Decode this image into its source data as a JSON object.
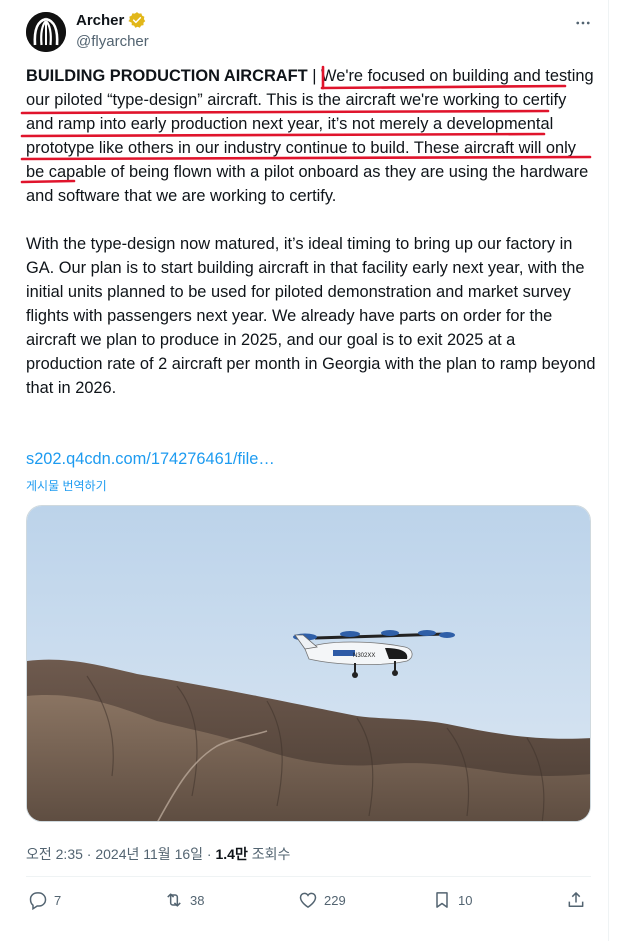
{
  "author": {
    "name": "Archer",
    "handle": "@flyarcher",
    "verified": true,
    "verified_color": "#e2b719",
    "avatar_icon": "archer-logo-icon"
  },
  "post": {
    "lines_p1": [
      "BUILDING PRODUCTION AIRCRAFT",
      " | ",
      "We're focused on building and testing our piloted “type-design” aircraft. This is the aircraft we're working to certify and ramp into early production next year, it’s not merely a developmental prototype like others in our industry continue to build.",
      " These aircraft will only be capable of being flown with a pilot onboard as they are using the hardware and software that we are working to certify."
    ],
    "paragraph2": "With the type-design now matured, it’s ideal timing to bring up our factory in GA. Our plan is to start building aircraft in that facility early next year, with the initial units planned to be used for piloted demonstration and market survey flights with passengers next year. We already have parts on order for the aircraft we plan to produce in 2025, and our goal is to exit 2025 at a production rate of 2 aircraft per month in Georgia with the plan to ramp beyond that in 2026.",
    "link_text": "s202.q4cdn.com/174276461/file…",
    "translate_label": "게시물 번역하기",
    "annotation_color": "#e0142c"
  },
  "media": {
    "aircraft_marking": "N302XX",
    "sky_color": "#c9dcef"
  },
  "meta": {
    "time": "오전 2:35",
    "date": "2024년 11월 16일",
    "views_count": "1.4만",
    "views_label": "조회수"
  },
  "actions": {
    "replies": "7",
    "reposts": "38",
    "likes": "229",
    "bookmarks": "10"
  },
  "colors": {
    "text": "#0f1419",
    "secondary": "#536471",
    "link": "#1d9bf0"
  }
}
